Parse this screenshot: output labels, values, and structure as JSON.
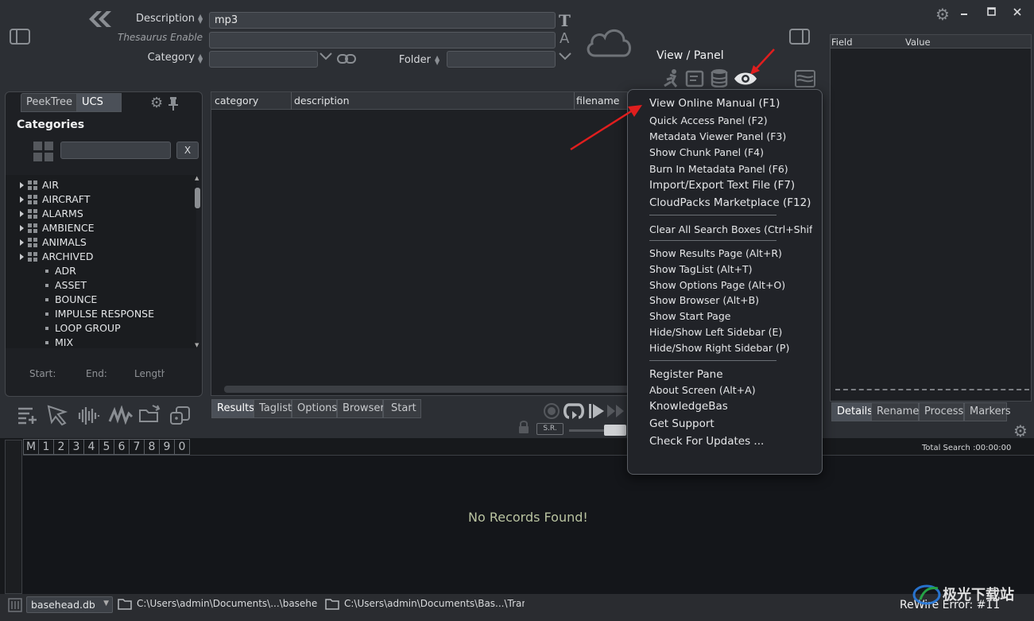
{
  "search": {
    "description_label": "Description",
    "description_value": "mp3",
    "thesaurus_label": "Thesaurus Enable",
    "thesaurus_value": "",
    "category_label": "Category",
    "category_value": "",
    "folder_label": "Folder",
    "folder_value": ""
  },
  "view_panel": {
    "label": "View / Panel"
  },
  "sidebar": {
    "tabs": [
      "PeekTree",
      "UCS"
    ],
    "heading": "Categories",
    "filter_value": "",
    "clear_label": "X",
    "items": [
      {
        "label": "AIR",
        "type": "parent"
      },
      {
        "label": "AIRCRAFT",
        "type": "parent"
      },
      {
        "label": "ALARMS",
        "type": "parent"
      },
      {
        "label": "AMBIENCE",
        "type": "parent"
      },
      {
        "label": "ANIMALS",
        "type": "parent"
      },
      {
        "label": "ARCHIVED",
        "type": "parent"
      },
      {
        "label": "ADR",
        "type": "child"
      },
      {
        "label": "ASSET",
        "type": "child"
      },
      {
        "label": "BOUNCE",
        "type": "child"
      },
      {
        "label": "IMPULSE RESPONSE",
        "type": "child"
      },
      {
        "label": "LOOP GROUP",
        "type": "child"
      },
      {
        "label": "MIX",
        "type": "child"
      }
    ],
    "start_label": "Start:",
    "end_label": "End:",
    "length_label": "Length"
  },
  "results": {
    "columns": [
      "category",
      "description",
      "filename"
    ],
    "tabs": [
      "Results",
      "Taglist",
      "Options",
      "Browser",
      "Start"
    ]
  },
  "transport": {
    "sr_label": "S.R."
  },
  "right_panel": {
    "columns": [
      "Field",
      "Value"
    ],
    "tabs": [
      "Details",
      "Rename",
      "Process",
      "Markers"
    ],
    "total_search": "Total Search :00:00:00"
  },
  "menu": {
    "groups": [
      [
        "View Online Manual (F1)",
        "Quick Access Panel (F2)",
        "Metadata Viewer Panel (F3)",
        "Show Chunk Panel (F4)",
        "Burn In Metadata Panel (F6)",
        "Import/Export Text File (F7)",
        "CloudPacks Marketplace (F12)"
      ],
      [
        "Clear All Search Boxes (Ctrl+Shift+C)"
      ],
      [
        "Show Results Page  (Alt+R)",
        "Show TagList  (Alt+T)",
        "Show Options Page  (Alt+O)",
        "Show Browser  (Alt+B)",
        "Show Start Page",
        "Hide/Show Left Sidebar (E)",
        "Hide/Show Right Sidebar (P)"
      ],
      [
        "Register Pane",
        "About Screen (Alt+A)",
        "KnowledgeBase",
        "Get Support",
        "Check For Updates ..."
      ]
    ]
  },
  "numbar": [
    "M",
    "1",
    "2",
    "3",
    "4",
    "5",
    "6",
    "7",
    "8",
    "9",
    "0"
  ],
  "no_records": "No Records Found!",
  "status": {
    "db": "basehead.db",
    "path1": "C:\\Users\\admin\\Documents\\...\\basehead",
    "path2": "C:\\Users\\admin\\Documents\\Bas...\\Trans",
    "rewire": "ReWire Error: #11"
  },
  "watermark": "极光下载站",
  "colors": {
    "accent_red": "#e01e1e",
    "menu_bg": "#212328",
    "panel_bg": "#1e2024"
  }
}
